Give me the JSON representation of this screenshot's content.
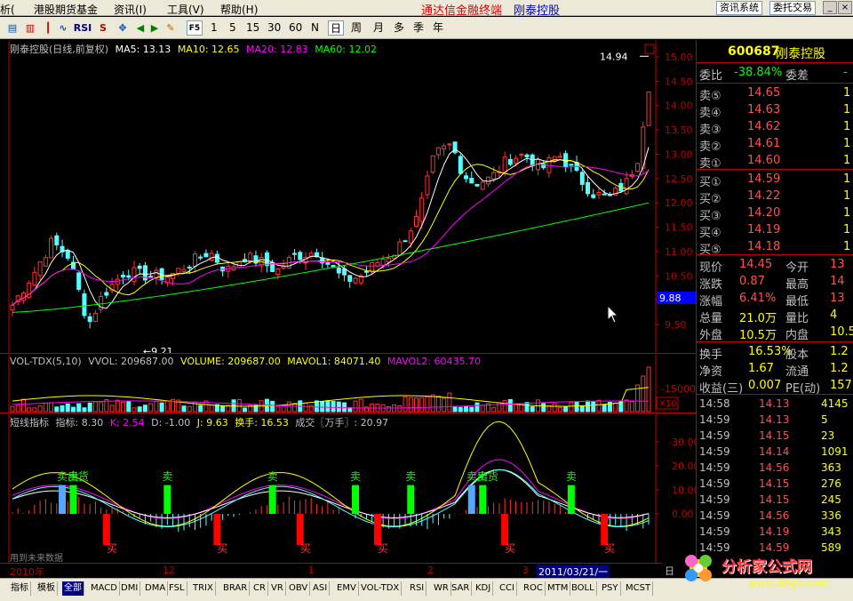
{
  "menubar": {
    "items": [
      "析(",
      "港股期货基金",
      "资讯(I)",
      "工具(V)",
      "帮助(H)"
    ],
    "app_title": "通达信金融终端",
    "stock_title": "刚泰控股",
    "btn_news": "资讯系统",
    "btn_trade": "委托交易"
  },
  "toolbar": {
    "icons": [
      "RSI",
      "S"
    ],
    "periods": [
      "1",
      "5",
      "15",
      "30",
      "60",
      "N",
      "日",
      "周",
      "月",
      "多",
      "季",
      "年"
    ],
    "active_period": "日",
    "f5": "F5"
  },
  "main_chart": {
    "legend_name": "刚泰控股(日线,前复权)",
    "ma5": "MA5: 13.13",
    "ma10": "MA10: 12.65",
    "ma20": "MA20: 12.83",
    "ma60": "MA60: 12.02",
    "high_label": "14.94",
    "low_label": "9.21",
    "current_price_tag": "9.88",
    "y_ticks": [
      "15.00",
      "14.50",
      "14.00",
      "13.50",
      "13.00",
      "12.50",
      "12.00",
      "11.50",
      "11.00",
      "10.50",
      "10.00",
      "9.50"
    ],
    "colors": {
      "up": "#ff3333",
      "down": "#54ffff",
      "ma5": "#ffffff",
      "ma10": "#ffff00",
      "ma20": "#ff00ff",
      "ma60": "#00ff00"
    }
  },
  "volume_chart": {
    "legend_name": "VOL-TDX(5,10)",
    "vvol": "VVOL: 209687.00",
    "volume": "VOLUME: 209687.00",
    "mavol1": "MAVOL1: 84071.40",
    "mavol2": "MAVOL2: 60435.70",
    "y_tick": "15000",
    "unit": "X10"
  },
  "indicator_chart": {
    "legend_name": "短线指标",
    "index_label": "指标: 8.30",
    "k": "K: 2.54",
    "d": "D: -1.00",
    "j": "J: 9.63",
    "turnover": "换手: 16.53",
    "deal": "成交〖万手〗: 20.97",
    "y_ticks": [
      "30.00",
      "20.00",
      "10.00",
      "0.00"
    ],
    "sell_label": "卖",
    "buy_label": "买",
    "sell_out_label": "卖出货",
    "footnote": "用到未来数据"
  },
  "time_axis": {
    "labels": [
      "2010年",
      "12",
      "1",
      "2",
      "3"
    ],
    "cursor_date": "2011/03/21/一",
    "right_label": "日"
  },
  "quote": {
    "code": "600687",
    "name": "刚泰控股",
    "weibi_label": "委比",
    "weibi_value": "-38.84%",
    "weicha_label": "委差",
    "weicha_value": "-",
    "asks": [
      {
        "label": "卖⑤",
        "price": "14.65",
        "vol": "1"
      },
      {
        "label": "卖④",
        "price": "14.63",
        "vol": "1"
      },
      {
        "label": "卖③",
        "price": "14.62",
        "vol": "1"
      },
      {
        "label": "卖②",
        "price": "14.61",
        "vol": "1"
      },
      {
        "label": "卖①",
        "price": "14.60",
        "vol": "1"
      }
    ],
    "bids": [
      {
        "label": "买①",
        "price": "14.59",
        "vol": "1"
      },
      {
        "label": "买②",
        "price": "14.22",
        "vol": "1"
      },
      {
        "label": "买③",
        "price": "14.20",
        "vol": "1"
      },
      {
        "label": "买④",
        "price": "14.19",
        "vol": "1"
      },
      {
        "label": "买⑤",
        "price": "14.18",
        "vol": "1"
      }
    ],
    "stats": [
      {
        "l1": "现价",
        "v1": "14.45",
        "l2": "今开",
        "v2": "13"
      },
      {
        "l1": "涨跌",
        "v1": "0.87",
        "l2": "最高",
        "v2": "14"
      },
      {
        "l1": "涨幅",
        "v1": "6.41%",
        "l2": "最低",
        "v2": "13"
      },
      {
        "l1": "总量",
        "v1": "21.0万",
        "l2": "量比",
        "v2": "4"
      },
      {
        "l1": "外盘",
        "v1": "10.5万",
        "l2": "内盘",
        "v2": "10.5"
      }
    ],
    "stats2": [
      {
        "l1": "换手",
        "v1": "16.53%",
        "l2": "股本",
        "v2": "1.2"
      },
      {
        "l1": "净资",
        "v1": "1.67",
        "l2": "流通",
        "v2": "1.2"
      },
      {
        "l1": "收益(三)",
        "v1": "0.007",
        "l2": "PE(动)",
        "v2": "157"
      }
    ],
    "ticks": [
      {
        "time": "14:58",
        "price": "14.13",
        "vol": "4145"
      },
      {
        "time": "14:59",
        "price": "14.13",
        "vol": "5"
      },
      {
        "time": "14:59",
        "price": "14.15",
        "vol": "23"
      },
      {
        "time": "14:59",
        "price": "14.14",
        "vol": "1091"
      },
      {
        "time": "14:59",
        "price": "14.56",
        "vol": "363"
      },
      {
        "time": "14:59",
        "price": "14.15",
        "vol": "276"
      },
      {
        "time": "14:59",
        "price": "14.15",
        "vol": "245"
      },
      {
        "time": "14:59",
        "price": "14.56",
        "vol": "336"
      },
      {
        "time": "14:59",
        "price": "14.19",
        "vol": "343"
      },
      {
        "time": "14:59",
        "price": "14.59",
        "vol": "589"
      }
    ]
  },
  "bottom_tabs": [
    "指标",
    "模板",
    "全部",
    "MACD",
    "DMI",
    "DMA",
    "FSL",
    "TRIX",
    "BRAR",
    "CR",
    "VR",
    "OBV",
    "ASI",
    "EMV",
    "VOL-TDX",
    "RSI",
    "WR",
    "SAR",
    "KDJ",
    "CCI",
    "ROC",
    "MTM",
    "BOLL",
    "PSY",
    "MCST"
  ],
  "logo": {
    "text": "分析家公式网",
    "url": "www.88gs.com"
  }
}
